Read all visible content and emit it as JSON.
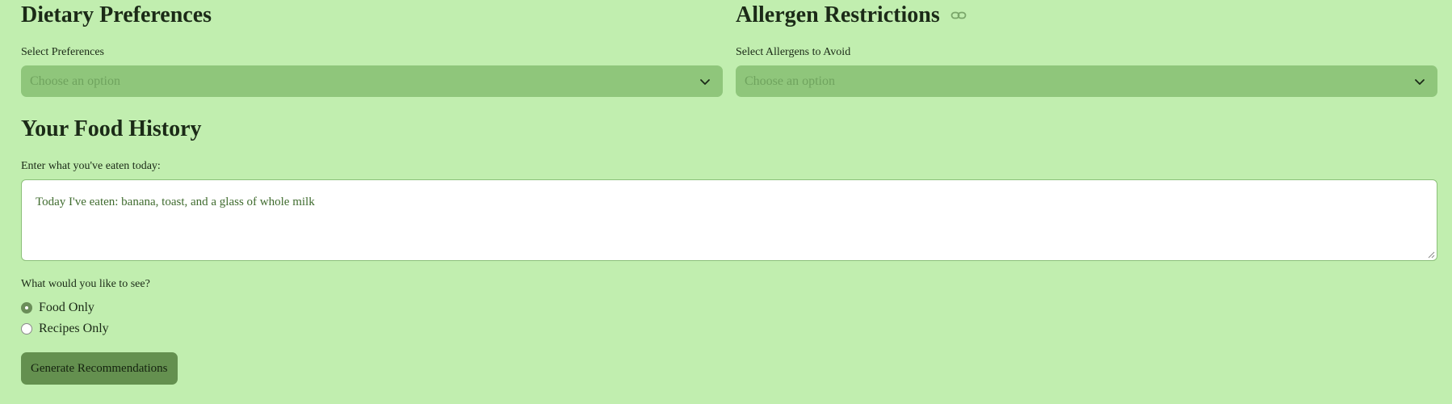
{
  "dietary": {
    "title": "Dietary Preferences",
    "select_label": "Select Preferences",
    "select_placeholder": "Choose an option"
  },
  "allergens": {
    "title": "Allergen Restrictions",
    "select_label": "Select Allergens to Avoid",
    "select_placeholder": "Choose an option"
  },
  "history": {
    "title": "Your Food History",
    "input_label": "Enter what you've eaten today:",
    "input_value": "Today I've eaten: banana, toast, and a glass of whole milk"
  },
  "view": {
    "question": "What would you like to see?",
    "options": [
      {
        "label": "Food Only",
        "selected": true
      },
      {
        "label": "Recipes Only",
        "selected": false
      }
    ]
  },
  "actions": {
    "generate_label": "Generate Recommendations"
  },
  "icons": {
    "link": "link-icon",
    "dropdown": "chevron-down-icon",
    "resize": "resize-grip-icon"
  },
  "colors": {
    "background": "#c1eeaf",
    "select_bg": "#8fc67b",
    "button_bg": "#64904f",
    "radio_checked": "#6b8e59"
  }
}
